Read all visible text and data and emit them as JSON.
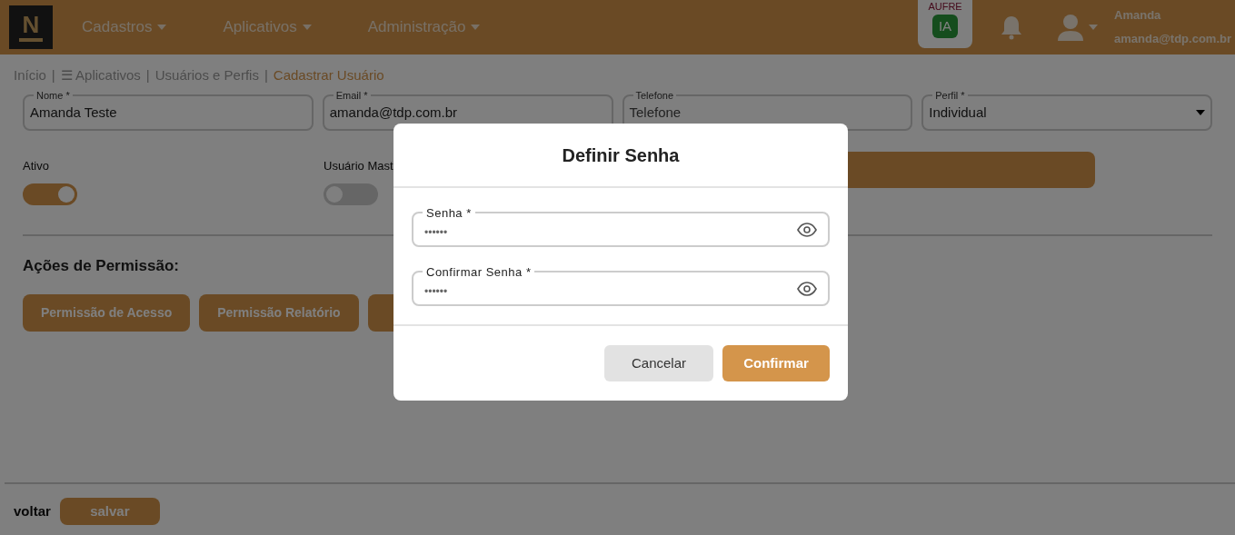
{
  "nav": {
    "logo": "N",
    "menus": [
      {
        "label": "Cadastros"
      },
      {
        "label": "Aplicativos"
      },
      {
        "label": "Administração"
      }
    ],
    "ai_badge": {
      "top": "AUFRE",
      "bubble": "IA"
    },
    "user": {
      "name": "Amanda",
      "email": "amanda@tdp.com.br"
    }
  },
  "breadcrumb_separator": "|",
  "breadcrumb": [
    {
      "label": "Início",
      "current": false
    },
    {
      "label": "☰ Aplicativos",
      "current": false
    },
    {
      "label": "Usuários e Perfis",
      "current": false
    },
    {
      "label": "Cadastrar Usuário",
      "current": true
    }
  ],
  "fields": [
    {
      "label": "Nome *",
      "value": "Amanda Teste"
    },
    {
      "label": "Email *",
      "value": "amanda@tdp.com.br"
    },
    {
      "label": "Telefone",
      "placeholder": "Telefone"
    },
    {
      "label": "Perfil *",
      "value": "Individual",
      "kind": "select"
    }
  ],
  "toggles": [
    {
      "label": "Ativo",
      "on": true
    },
    {
      "label": "Usuário Mast",
      "on": false
    }
  ],
  "permissions": {
    "title": "Ações de Permissão:",
    "buttons": [
      "Permissão de Acesso",
      "Permissão Relatório"
    ]
  },
  "footer": {
    "back": "voltar",
    "save": "salvar"
  },
  "dialog": {
    "title": "Definir Senha",
    "fields": [
      {
        "label": "Senha *",
        "value": "••••••"
      },
      {
        "label": "Confirmar Senha *",
        "value": "••••••"
      }
    ],
    "cancel": "Cancelar",
    "confirm": "Confirmar"
  }
}
